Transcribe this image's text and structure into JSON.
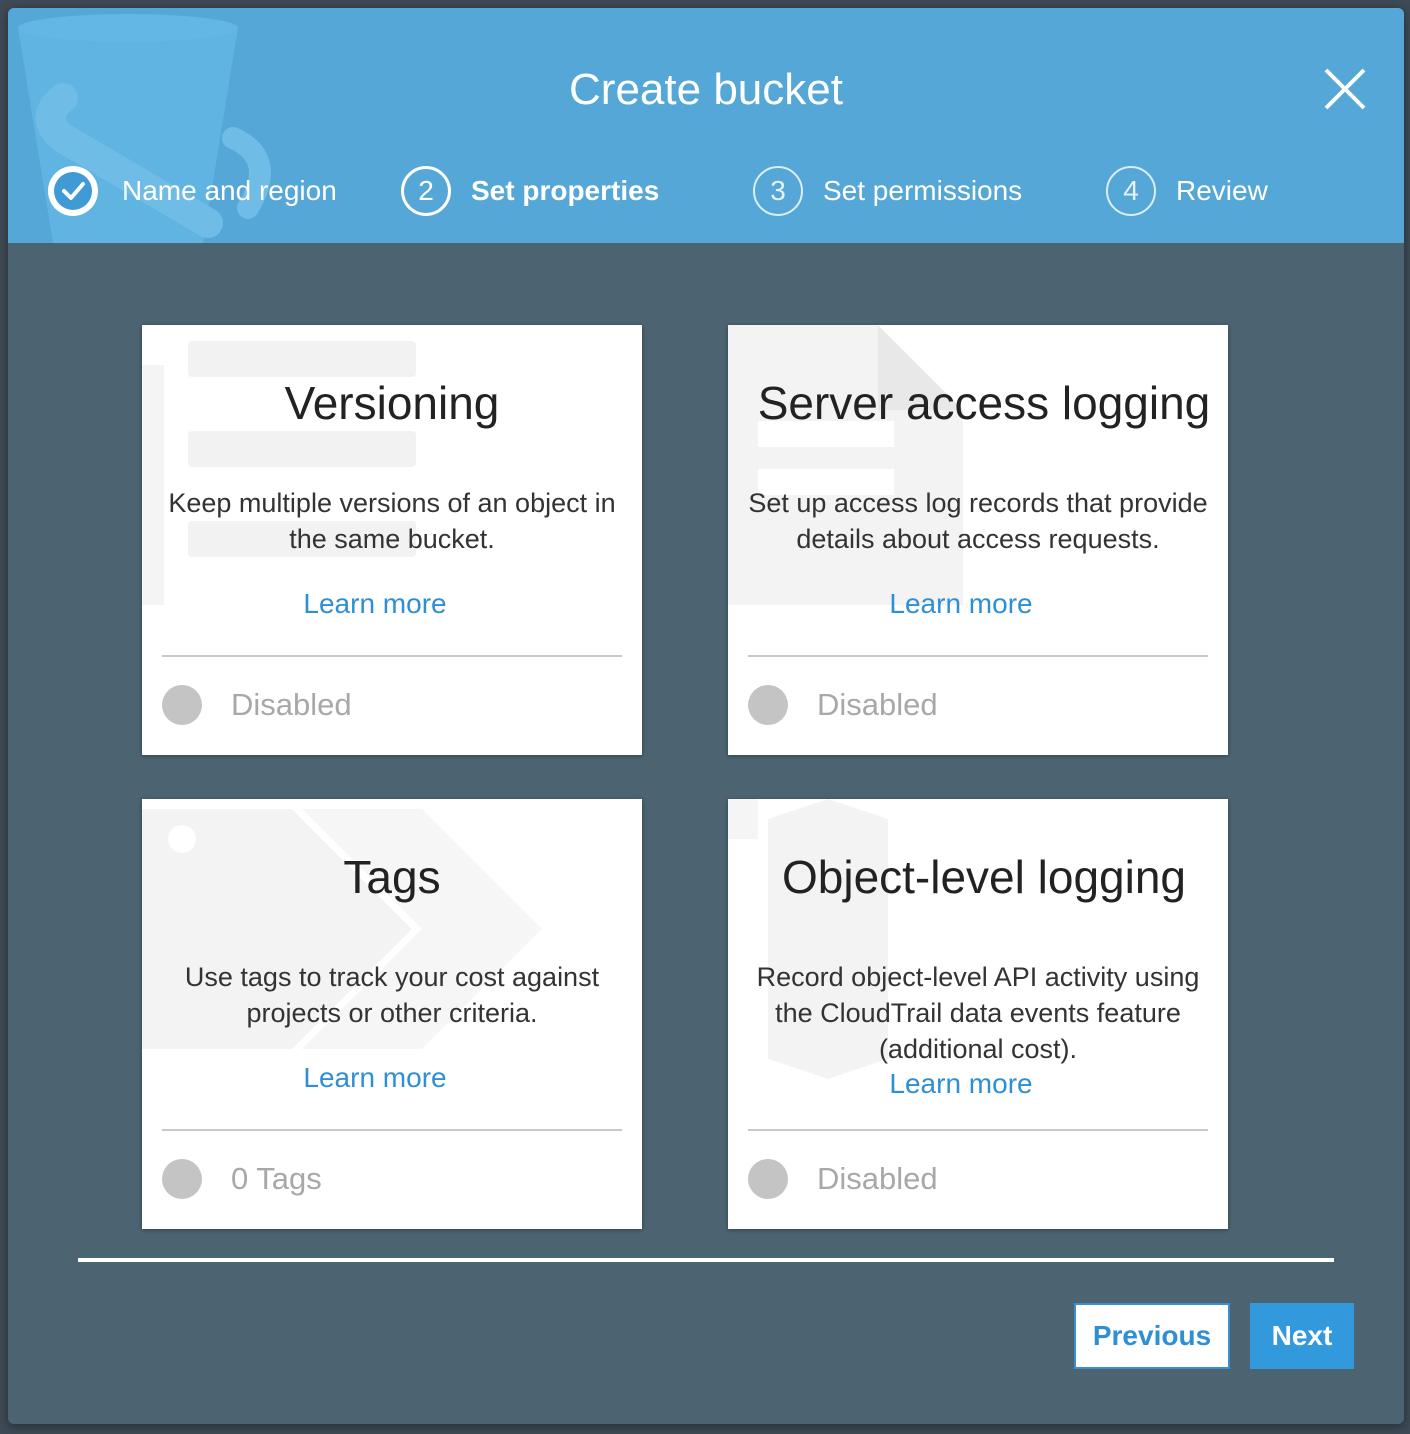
{
  "modal": {
    "title": "Create bucket",
    "close_icon": "close-icon"
  },
  "steps": [
    {
      "number": "",
      "label": "Name and region",
      "state": "completed",
      "icon": "checkmark-icon"
    },
    {
      "number": "2",
      "label": "Set properties",
      "state": "current"
    },
    {
      "number": "3",
      "label": "Set permissions",
      "state": "upcoming"
    },
    {
      "number": "4",
      "label": "Review",
      "state": "upcoming"
    }
  ],
  "cards": [
    {
      "title": "Versioning",
      "description": "Keep multiple versions of an object in the same bucket.",
      "link": "Learn more",
      "status": "Disabled"
    },
    {
      "title": "Server access logging",
      "description": "Set up access log records that provide details about access requests.",
      "link": "Learn more",
      "status": "Disabled"
    },
    {
      "title": "Tags",
      "description": "Use tags to track your cost against projects or other criteria.",
      "link": "Learn more",
      "status": "0 Tags"
    },
    {
      "title": "Object-level logging",
      "description": "Record object-level API activity using the CloudTrail data events feature (additional cost).",
      "link": "Learn more",
      "status": "Disabled"
    }
  ],
  "footer": {
    "previous_label": "Previous",
    "next_label": "Next"
  },
  "colors": {
    "header": "#55a7d8",
    "body": "#4c6371",
    "link": "#2e8fd4",
    "primary_button": "#3399dd"
  }
}
